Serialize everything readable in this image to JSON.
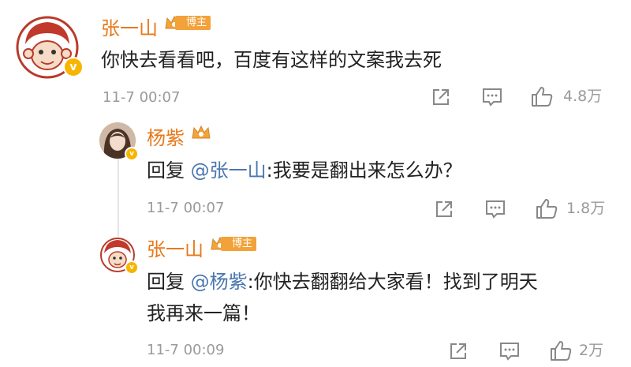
{
  "comments": [
    {
      "username": "张一山",
      "badge": "博主",
      "text": "你快去看看吧，百度有这样的文案我去死",
      "time": "11-7 00:07",
      "like_count": "4.8万",
      "icons": [
        "crown-icon",
        "verified-icon",
        "share-icon",
        "comment-icon",
        "like-icon"
      ]
    }
  ],
  "replies": [
    {
      "username": "杨紫",
      "reply_prefix": "回复",
      "mention": "@张一山",
      "text": ":我要是翻出来怎么办？",
      "time": "11-7 00:07",
      "like_count": "1.8万"
    },
    {
      "username": "张一山",
      "badge": "博主",
      "reply_prefix": "回复",
      "mention": "@杨紫",
      "text_line1": ":你快去翻翻给大家看！找到了明天",
      "text_line2": "我再来一篇！",
      "time": "11-7 00:09",
      "like_count": "2万"
    }
  ],
  "colors": {
    "username": "#e8791b",
    "mention": "#4a76b0",
    "meta": "#9a9a9a",
    "badge": "#f3a23a",
    "verified": "#f7b500"
  }
}
